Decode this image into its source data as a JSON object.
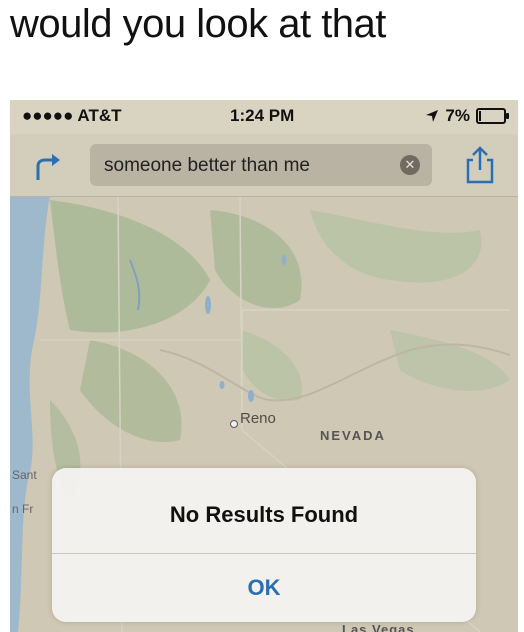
{
  "caption": "would you look at that",
  "status_bar": {
    "carrier": "●●●●● AT&T",
    "time": "1:24 PM",
    "battery": "7%",
    "battery_level": 0.07
  },
  "nav": {
    "search_query": "someone better than me",
    "clear_glyph": "✕",
    "icons": [
      "directions-arrow-icon",
      "clear-icon",
      "share-icon"
    ]
  },
  "map": {
    "labels": {
      "reno": "Reno",
      "nevada": "NEVADA",
      "sant": "Sant",
      "nfr": "n Fr",
      "las_vegas": "Las Vegas"
    }
  },
  "alert": {
    "title": "No Results Found",
    "ok_label": "OK"
  },
  "colors": {
    "map_land": "#cfc8b4",
    "forest": "#a8b896",
    "water": "#9fb9cc",
    "link_blue": "#2b6fb0"
  }
}
